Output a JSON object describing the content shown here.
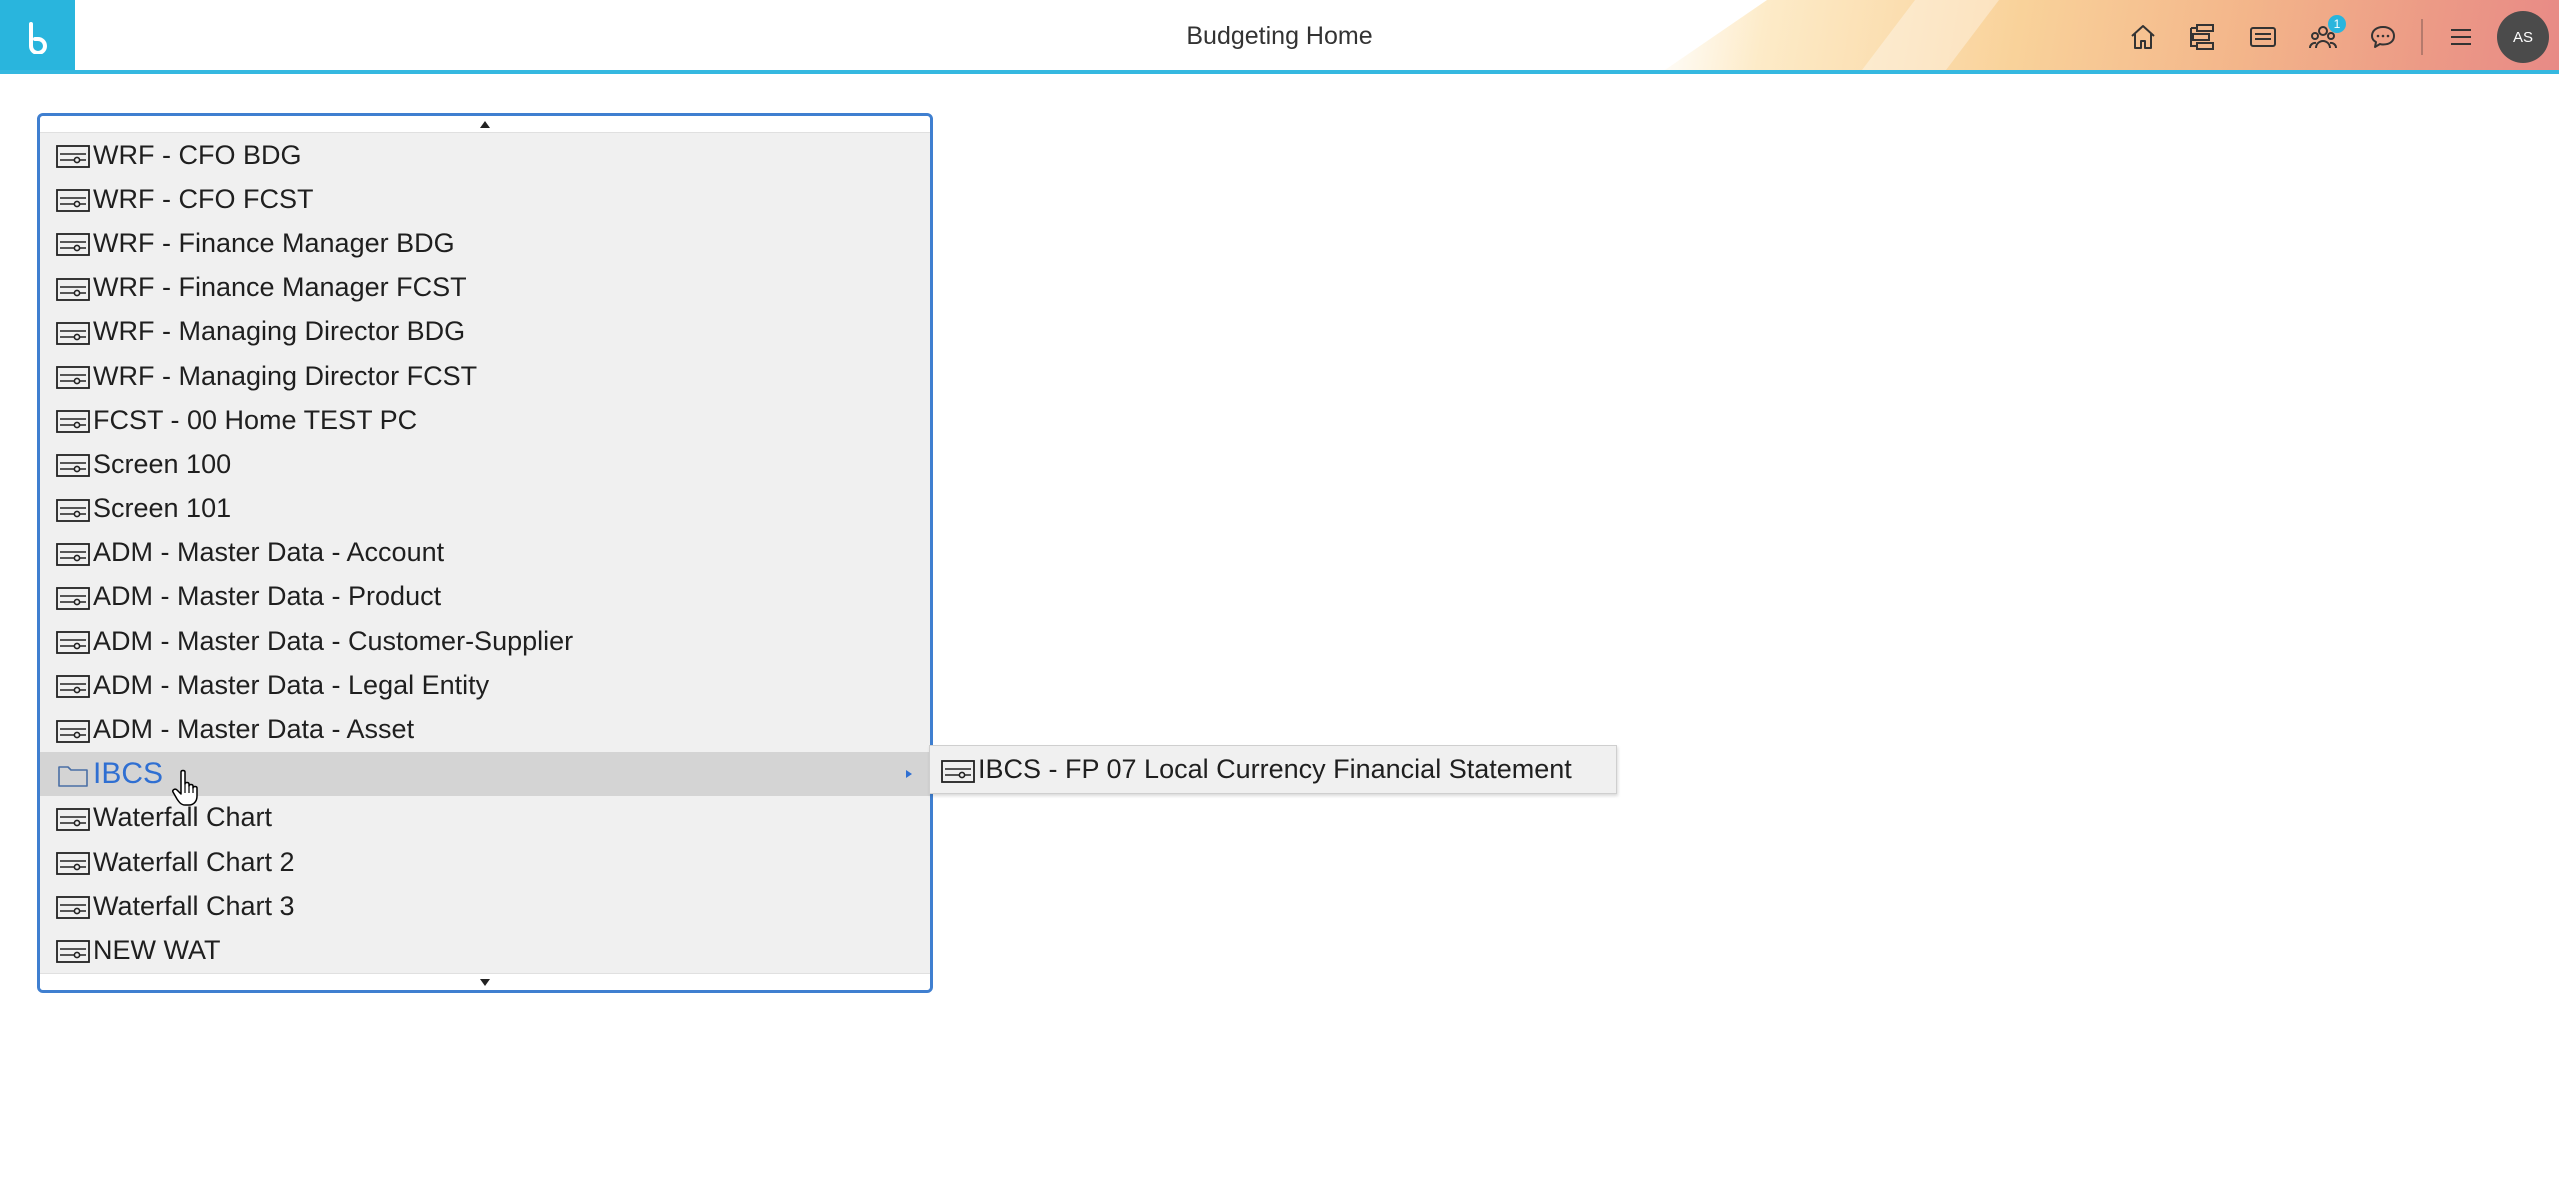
{
  "header": {
    "title": "Budgeting Home",
    "logo_letter": "b",
    "notification_count": "1",
    "avatar_initials": "AS",
    "accent_color": "#29b5dd",
    "icons": [
      "home-icon",
      "hierarchy-icon",
      "card-icon",
      "users-icon",
      "chat-icon",
      "hamburger-menu-icon"
    ]
  },
  "menu": {
    "items": [
      {
        "label": "WRF - CFO BDG",
        "icon": "dashboard-icon"
      },
      {
        "label": "WRF - CFO FCST",
        "icon": "dashboard-icon"
      },
      {
        "label": "WRF - Finance Manager BDG",
        "icon": "dashboard-icon"
      },
      {
        "label": "WRF - Finance Manager FCST",
        "icon": "dashboard-icon"
      },
      {
        "label": "WRF - Managing Director BDG",
        "icon": "dashboard-icon"
      },
      {
        "label": "WRF - Managing Director FCST",
        "icon": "dashboard-icon"
      },
      {
        "label": "FCST - 00 Home TEST PC",
        "icon": "dashboard-icon"
      },
      {
        "label": "Screen 100",
        "icon": "dashboard-icon"
      },
      {
        "label": "Screen 101",
        "icon": "dashboard-icon"
      },
      {
        "label": "ADM - Master Data - Account",
        "icon": "dashboard-icon"
      },
      {
        "label": "ADM - Master Data - Product",
        "icon": "dashboard-icon"
      },
      {
        "label": "ADM - Master Data - Customer-Supplier",
        "icon": "dashboard-icon"
      },
      {
        "label": "ADM - Master Data - Legal Entity",
        "icon": "dashboard-icon"
      },
      {
        "label": "ADM - Master Data - Asset",
        "icon": "dashboard-icon"
      },
      {
        "label": "IBCS",
        "icon": "folder-icon",
        "active": true,
        "has_submenu": true
      },
      {
        "label": "Waterfall Chart",
        "icon": "dashboard-icon"
      },
      {
        "label": "Waterfall Chart 2",
        "icon": "dashboard-icon"
      },
      {
        "label": "Waterfall Chart 3",
        "icon": "dashboard-icon"
      },
      {
        "label": "NEW WAT",
        "icon": "dashboard-icon"
      }
    ]
  },
  "submenu": {
    "items": [
      {
        "label": "IBCS - FP 07 Local Currency Financial Statement",
        "icon": "dashboard-icon"
      }
    ]
  }
}
